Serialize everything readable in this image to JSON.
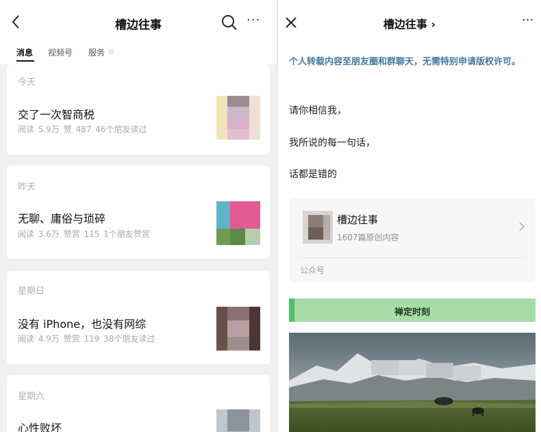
{
  "left": {
    "header": {
      "title": "槽边往事",
      "more_label": "···"
    },
    "tabs": [
      {
        "label": "消息"
      },
      {
        "label": "视频号"
      },
      {
        "label": "服务"
      }
    ],
    "tab_suffix": "≡",
    "articles": [
      {
        "day": "今天",
        "title": "交了一次智商税",
        "meta": "阅读 5.9万  赞 487  46个朋友读过"
      },
      {
        "day": "昨天",
        "title": "无聊、庸俗与琐碎",
        "meta": "阅读 3.6万  赞赏 115  1个朋友赞赏"
      },
      {
        "day": "星期日",
        "title": "没有 iPhone，也没有网综",
        "meta": "阅读 4.9万  赞赏 119  38个朋友读过"
      },
      {
        "day": "星期六",
        "title": "心性败坏",
        "meta": ""
      }
    ]
  },
  "right": {
    "header": {
      "title": "槽边往事 ›",
      "more_label": "···"
    },
    "notice": "个人转载内容至朋友圈和群聊天，无需特别申请版权许可。",
    "paragraphs": [
      "请你相信我，",
      "我所说的每一句话，",
      "话都是错的"
    ],
    "account": {
      "name": "槽边往事",
      "count": "1607篇原创内容",
      "type": "公众号"
    },
    "section_title": "禅定时刻"
  },
  "colors": {
    "link_blue": "#46799e",
    "section_green": "#a8dca6",
    "accent_green": "#53bd6c"
  }
}
